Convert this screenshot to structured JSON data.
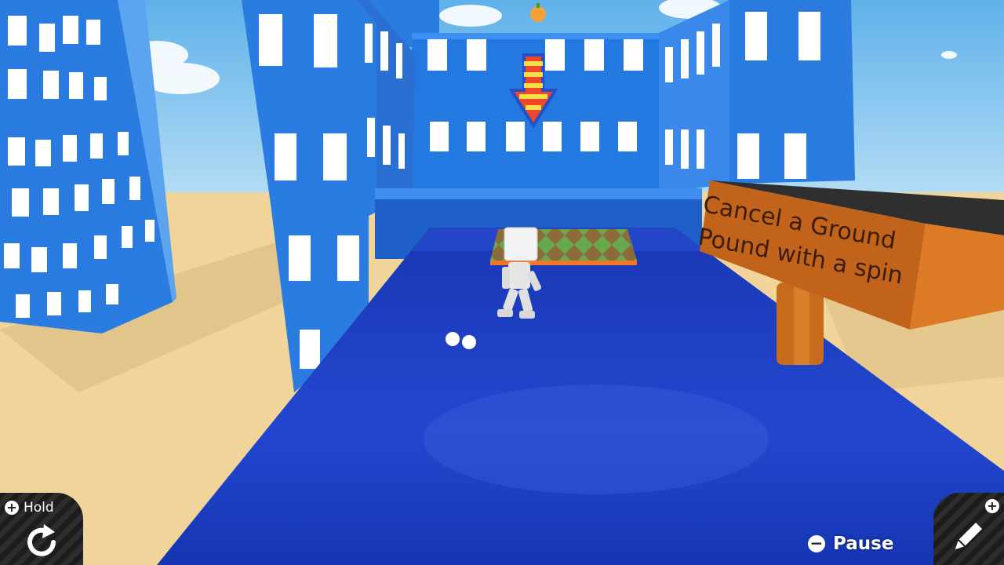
{
  "sign": {
    "line1": "Cancel a Ground",
    "line2": "Pound with a spin"
  },
  "hud": {
    "hold_button": {
      "glyph": "+",
      "label": "Hold",
      "icon": "rotate-icon"
    },
    "pause_button": {
      "glyph": "−",
      "label": "Pause"
    },
    "edit_button": {
      "glyph": "+",
      "icon": "pencil-icon"
    }
  },
  "colors": {
    "sky": "#7fc4ef",
    "sand": "#f0d49a",
    "building_blue": "#2f7de3",
    "platform_blue": "#1d3fc2",
    "sign_orange": "#c2631c",
    "hud_dark": "#1e1e1e"
  }
}
